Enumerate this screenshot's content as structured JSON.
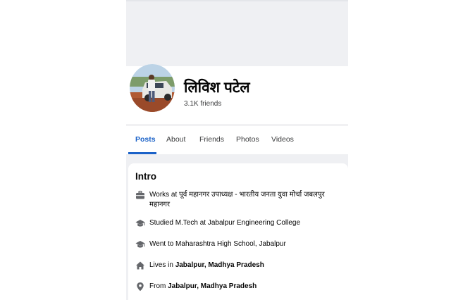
{
  "profile": {
    "name": "लिविश पटेल",
    "friends": "3.1K friends"
  },
  "tabs": [
    {
      "label": "Posts",
      "active": true
    },
    {
      "label": "About",
      "active": false
    },
    {
      "label": "Friends",
      "active": false
    },
    {
      "label": "Photos",
      "active": false
    },
    {
      "label": "Videos",
      "active": false
    }
  ],
  "intro": {
    "title": "Intro",
    "items": [
      {
        "icon": "briefcase-icon",
        "prefix": "Works at ",
        "bold": "",
        "text": "पूर्व महानगर उपाध्यक्ष - भारतीय जनता युवा मोर्चा जबलपुर महानगर"
      },
      {
        "icon": "graduation-cap-icon",
        "prefix": "Studied M.Tech at Jabalpur Engineering College",
        "bold": "",
        "text": ""
      },
      {
        "icon": "graduation-cap-icon",
        "prefix": "Went to Maharashtra High School, Jabalpur",
        "bold": "",
        "text": ""
      },
      {
        "icon": "home-icon",
        "prefix": "Lives in ",
        "bold": "Jabalpur, Madhya Pradesh",
        "text": ""
      },
      {
        "icon": "location-pin-icon",
        "prefix": "From ",
        "bold": "Jabalpur, Madhya Pradesh",
        "text": ""
      }
    ]
  },
  "colors": {
    "accent": "#1b62c8",
    "page_bg": "#eff0f3",
    "icon": "#65676b"
  }
}
